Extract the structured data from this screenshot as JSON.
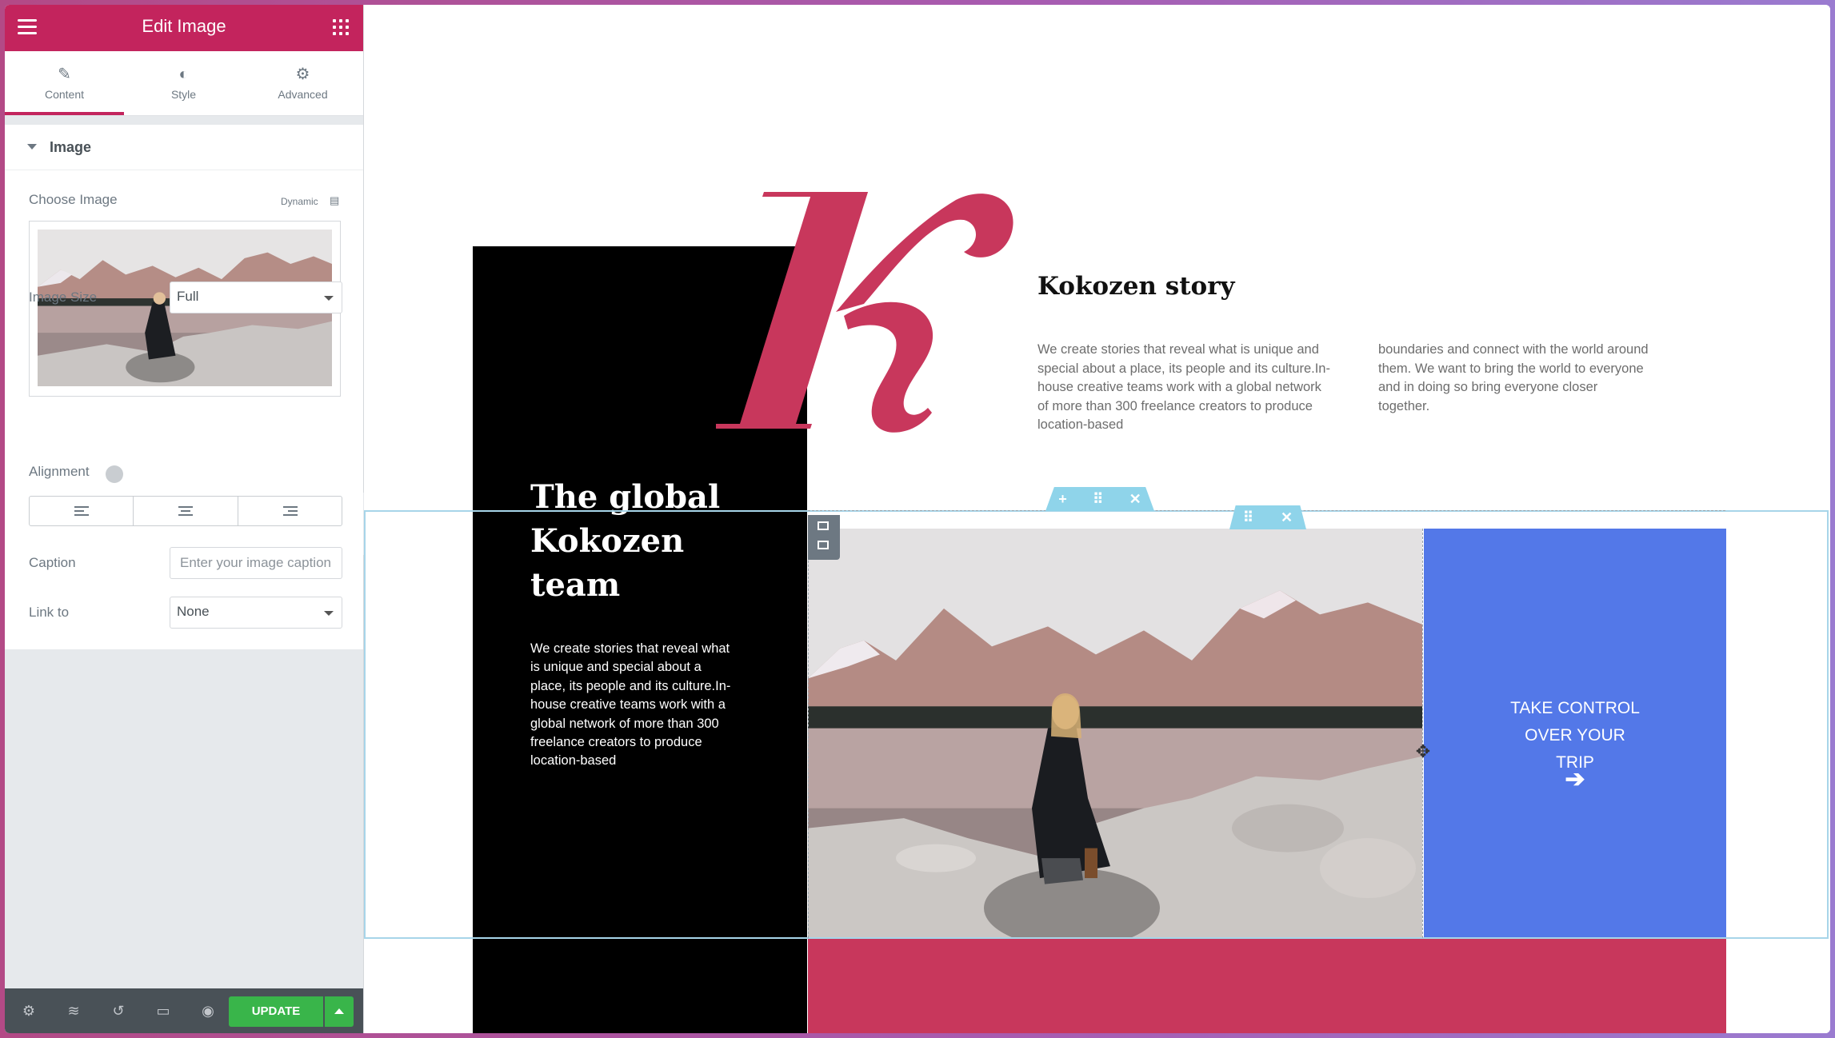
{
  "panel": {
    "header_title": "Edit Image",
    "tabs": [
      {
        "label": "Content",
        "icon": "pencil-icon",
        "active": true
      },
      {
        "label": "Style",
        "icon": "contrast-icon",
        "active": false
      },
      {
        "label": "Advanced",
        "icon": "gear-icon",
        "active": false
      }
    ],
    "section_title": "Image",
    "choose_image_label": "Choose Image",
    "dynamic_label": "Dynamic",
    "image_size_label": "Image Size",
    "image_size_value": "Full",
    "alignment_label": "Alignment",
    "caption_label": "Caption",
    "caption_placeholder": "Enter your image caption",
    "link_label": "Link to",
    "link_value": "None",
    "update_label": "UPDATE",
    "accent_color": "#c3245d",
    "update_color": "#39b54a"
  },
  "canvas": {
    "story_title": "Kokozen story",
    "story_col1": "We create stories that reveal what is unique and special about a place, its people and its culture.In-house creative teams work with a global network of more than 300 freelance creators to produce location-based",
    "story_col2": "boundaries and connect with the world around them. We want to bring the world to everyone and in doing so bring everyone closer together.",
    "global_title": "The global Kokozen team",
    "global_text": "We create stories that reveal what is unique and special about a place, its people and its culture.In-house creative teams work with a global network of more than 300 freelance creators to produce location-based",
    "cta_text": "TAKE CONTROL OVER YOUR TRIP",
    "cta_arrow": "➔",
    "colors": {
      "brand_red": "#c8375c",
      "cta_blue": "#5378e8",
      "black_column": "#000000",
      "selection": "#a7d5e9"
    }
  }
}
